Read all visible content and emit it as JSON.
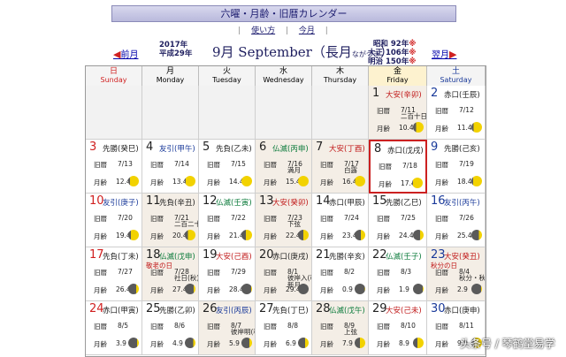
{
  "header": {
    "title": "六曜・月齢・旧暦カレンダー",
    "nav": [
      "使い方",
      "今月"
    ],
    "prev_label": "前月",
    "next_label": "翌月",
    "year_western": "2017年",
    "year_heisei": "平成29年",
    "month_label": "9月 September（長月",
    "month_kana": "ながつき",
    "month_close": "）",
    "eras": [
      {
        "label": "昭和 92年",
        "mark": "※"
      },
      {
        "label": "大正 106年",
        "mark": "※"
      },
      {
        "label": "明治 150年",
        "mark": "※"
      }
    ]
  },
  "weekdays": [
    {
      "jp": "日",
      "en": "Sunday"
    },
    {
      "jp": "月",
      "en": "Monday"
    },
    {
      "jp": "火",
      "en": "Tuesday"
    },
    {
      "jp": "水",
      "en": "Wednesday"
    },
    {
      "jp": "木",
      "en": "Thursday"
    },
    {
      "jp": "金",
      "en": "Friday"
    },
    {
      "jp": "土",
      "en": "Saturday"
    }
  ],
  "labels": {
    "kyureki": "旧暦",
    "getsurei": "月齢"
  },
  "days": [
    {
      "d": "1",
      "rokuyo": "大安(辛卯)",
      "c": "red",
      "kyu": "7/11",
      "age": "10.4",
      "notes": [
        "二百十日"
      ],
      "phase": 0.7
    },
    {
      "d": "2",
      "rokuyo": "赤口(壬辰)",
      "c": "dark",
      "kyu": "7/12",
      "age": "11.4",
      "notes": [],
      "phase": 0.8
    },
    {
      "d": "3",
      "rokuyo": "先勝(癸巳)",
      "c": "dark",
      "kyu": "7/13",
      "age": "12.4",
      "notes": [],
      "phase": 0.85
    },
    {
      "d": "4",
      "rokuyo": "友引(甲午)",
      "c": "blue",
      "kyu": "7/14",
      "age": "13.4",
      "notes": [],
      "phase": 0.9
    },
    {
      "d": "5",
      "rokuyo": "先負(乙未)",
      "c": "dark",
      "kyu": "7/15",
      "age": "14.4",
      "notes": [],
      "phase": 1.0
    },
    {
      "d": "6",
      "rokuyo": "仏滅(丙申)",
      "c": "green",
      "kyu": "7/16",
      "age": "15.4",
      "notes": [
        "満月"
      ],
      "phase": 1.0
    },
    {
      "d": "7",
      "rokuyo": "大安(丁酉)",
      "c": "red",
      "kyu": "7/17",
      "age": "16.4",
      "notes": [
        "白露"
      ],
      "phase": 0.95
    },
    {
      "d": "8",
      "rokuyo": "赤口(戊戌)",
      "c": "dark",
      "kyu": "7/18",
      "age": "17.4",
      "notes": [],
      "phase": 0.9
    },
    {
      "d": "9",
      "rokuyo": "先勝(己亥)",
      "c": "dark",
      "kyu": "7/19",
      "age": "18.4",
      "notes": [],
      "phase": 0.85
    },
    {
      "d": "10",
      "rokuyo": "友引(庚子)",
      "c": "blue",
      "kyu": "7/20",
      "age": "19.4",
      "notes": [],
      "phase": 0.75
    },
    {
      "d": "11",
      "rokuyo": "先負(辛丑)",
      "c": "dark",
      "kyu": "7/21",
      "age": "20.4",
      "notes": [
        "二百二十日"
      ],
      "phase": 0.7
    },
    {
      "d": "12",
      "rokuyo": "仏滅(壬寅)",
      "c": "green",
      "kyu": "7/22",
      "age": "21.4",
      "notes": [],
      "phase": 0.6
    },
    {
      "d": "13",
      "rokuyo": "大安(癸卯)",
      "c": "red",
      "kyu": "7/23",
      "age": "22.4",
      "notes": [
        "下弦"
      ],
      "phase": 0.5
    },
    {
      "d": "14",
      "rokuyo": "赤口(甲辰)",
      "c": "dark",
      "kyu": "7/24",
      "age": "23.4",
      "notes": [],
      "phase": 0.4
    },
    {
      "d": "15",
      "rokuyo": "先勝(乙巳)",
      "c": "dark",
      "kyu": "7/25",
      "age": "24.4",
      "notes": [],
      "phase": 0.35
    },
    {
      "d": "16",
      "rokuyo": "友引(丙午)",
      "c": "blue",
      "kyu": "7/26",
      "age": "25.4",
      "notes": [],
      "phase": 0.3
    },
    {
      "d": "17",
      "rokuyo": "先負(丁未)",
      "c": "dark",
      "kyu": "7/27",
      "age": "26.4",
      "notes": [],
      "phase": 0.25
    },
    {
      "d": "18",
      "rokuyo": "仏滅(戊申)",
      "c": "green",
      "kyu": "7/28",
      "age": "27.4",
      "notes": [
        "社日(秋)"
      ],
      "tag": "敬老の日",
      "phase": 0.15
    },
    {
      "d": "19",
      "rokuyo": "大安(己酉)",
      "c": "red",
      "kyu": "7/29",
      "age": "28.4",
      "notes": [],
      "phase": 0.1
    },
    {
      "d": "20",
      "rokuyo": "赤口(庚戌)",
      "c": "dark",
      "kyu": "8/1",
      "age": "29.4",
      "notes": [
        "彼岸入(秋)",
        "新月"
      ],
      "phase": 0.0
    },
    {
      "d": "21",
      "rokuyo": "先勝(辛亥)",
      "c": "dark",
      "kyu": "8/2",
      "age": "0.9",
      "notes": [],
      "phase": 0.05
    },
    {
      "d": "22",
      "rokuyo": "仏滅(壬子)",
      "c": "green",
      "kyu": "8/3",
      "age": "1.9",
      "notes": [],
      "phase": 0.08
    },
    {
      "d": "23",
      "rokuyo": "大安(癸丑)",
      "c": "red",
      "kyu": "8/4",
      "age": "2.9",
      "notes": [
        "秋分・秋の彼岸"
      ],
      "tag": "秋分の日",
      "phase": 0.1
    },
    {
      "d": "24",
      "rokuyo": "赤口(甲寅)",
      "c": "dark",
      "kyu": "8/5",
      "age": "3.9",
      "notes": [],
      "phase": 0.15
    },
    {
      "d": "25",
      "rokuyo": "先勝(乙卯)",
      "c": "dark",
      "kyu": "8/6",
      "age": "4.9",
      "notes": [],
      "phase": 0.2
    },
    {
      "d": "26",
      "rokuyo": "友引(丙辰)",
      "c": "blue",
      "kyu": "8/7",
      "age": "5.9",
      "notes": [
        "彼岸明(秋)"
      ],
      "phase": 0.25
    },
    {
      "d": "27",
      "rokuyo": "先負(丁巳)",
      "c": "dark",
      "kyu": "8/8",
      "age": "6.9",
      "notes": [],
      "phase": 0.35
    },
    {
      "d": "28",
      "rokuyo": "仏滅(戊午)",
      "c": "green",
      "kyu": "8/9",
      "age": "7.9",
      "notes": [
        "上弦"
      ],
      "phase": 0.5
    },
    {
      "d": "29",
      "rokuyo": "大安(己未)",
      "c": "red",
      "kyu": "8/10",
      "age": "8.9",
      "notes": [],
      "phase": 0.6
    },
    {
      "d": "30",
      "rokuyo": "赤口(庚申)",
      "c": "dark",
      "kyu": "8/11",
      "age": "9.9",
      "notes": [],
      "phase": 0.7
    }
  ],
  "today": "8",
  "watermark": "头条号 / 琴鹤堂易学"
}
